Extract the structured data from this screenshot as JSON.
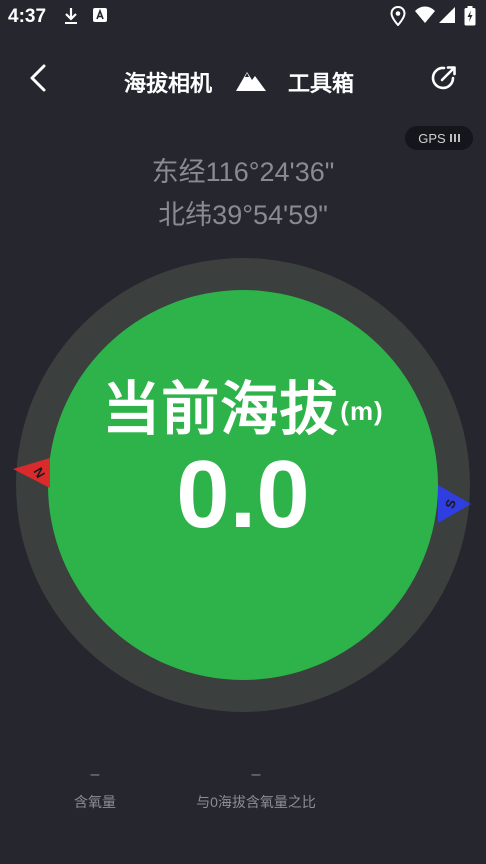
{
  "status_bar": {
    "time": "4:37",
    "icons": [
      "download-icon",
      "font-a-icon",
      "location-icon",
      "wifi-icon",
      "signal-icon",
      "battery-charging-icon"
    ]
  },
  "app_bar": {
    "title_left": "海拔相机",
    "title_right": "工具箱",
    "icons": [
      "back-arrow-icon",
      "mountain-icon",
      "share-icon"
    ]
  },
  "gps": {
    "label": "GPS"
  },
  "coordinates": {
    "longitude": "东经116°24'36\"",
    "latitude": "北纬39°54'59\""
  },
  "altitude": {
    "label": "当前海拔",
    "unit": "(m)",
    "value": "0.0"
  },
  "compass": {
    "north": "N",
    "south": "S"
  },
  "stats": {
    "oxygen": {
      "value": "–",
      "label": "含氧量"
    },
    "ratio": {
      "value": "–",
      "label": "与0海拔含氧量之比"
    }
  },
  "colors": {
    "background": "#25262e",
    "dial_ring": "#3b3f3e",
    "dial_face": "#2db34a",
    "north_marker": "#d92b2b",
    "south_marker": "#2f3ee0"
  }
}
